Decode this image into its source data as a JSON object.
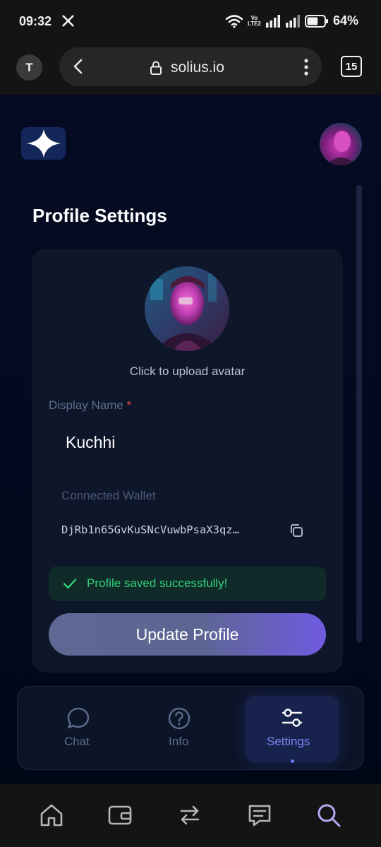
{
  "status_bar": {
    "time": "09:32",
    "network_badge_top": "Vo",
    "network_badge_bottom": "LTE2",
    "battery_percent": "64%",
    "battery_level": 0.64
  },
  "browser": {
    "tab_initial": "T",
    "url": "solius.io",
    "tab_count": "15"
  },
  "page": {
    "title": "Profile Settings",
    "avatar_hint": "Click to upload avatar",
    "display_name_label": "Display Name",
    "required_mark": "*",
    "display_name_value": "Kuchhi",
    "wallet_label": "Connected Wallet",
    "wallet_address": "DjRb1n65GvKuSNcVuwbPsaX3qz…",
    "success_message": "Profile saved successfully!",
    "update_button": "Update Profile"
  },
  "bottom_nav": {
    "items": [
      {
        "label": "Chat",
        "icon": "chat-bubble-icon",
        "active": false
      },
      {
        "label": "Info",
        "icon": "question-circle-icon",
        "active": false
      },
      {
        "label": "Settings",
        "icon": "sliders-icon",
        "active": true
      }
    ]
  },
  "android_nav": {
    "icons": [
      "home-icon",
      "wallet-icon",
      "swap-icon",
      "messages-icon",
      "search-icon"
    ]
  },
  "colors": {
    "page_bg": "#030a1e",
    "card_bg": "#0e1629",
    "success_text": "#34d27b",
    "accent": "#6a7cf5",
    "active_nav_label": "#7b86f0"
  }
}
